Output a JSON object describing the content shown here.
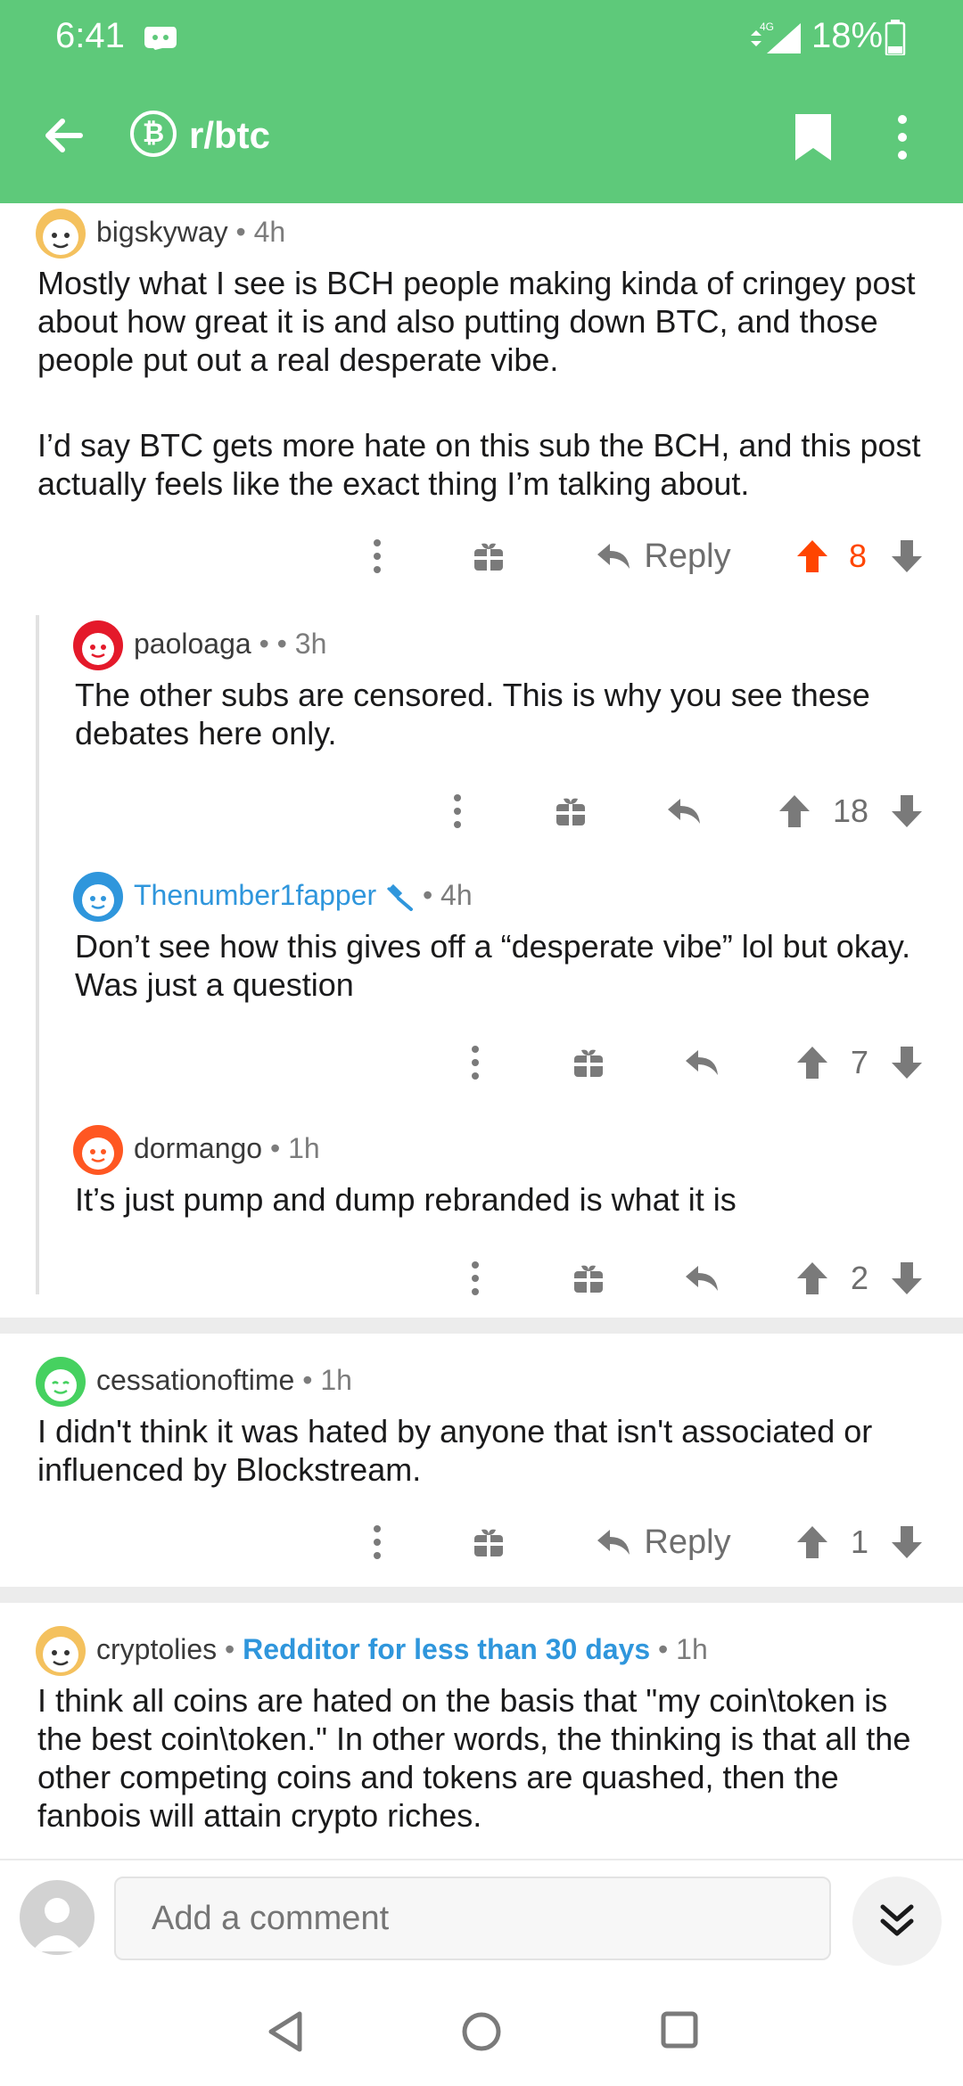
{
  "status_bar": {
    "time": "6:41",
    "network": "4G",
    "battery": "18%"
  },
  "toolbar": {
    "subreddit": "r/btc",
    "subreddit_icon": "bitcoin-icon"
  },
  "colors": {
    "header": "#5ec97a",
    "upvote_active": "#ff4500",
    "link_blue": "#2f96dc"
  },
  "comments": [
    {
      "author": "bigskyway",
      "sep": "•",
      "age": "4h",
      "text_p1": "Mostly what I see is BCH people making kinda of cringey post about how great it is and also putting down BTC, and those people put out a real desperate vibe.",
      "text_p2": "I’d say BTC gets more hate on this sub the BCH, and this post actually feels like the exact thing I’m talking about.",
      "reply_label": "Reply",
      "score": "8",
      "upvoted": true
    },
    {
      "author": "paoloaga",
      "sep": "• •",
      "age": "3h",
      "text": "The other subs are censored. This is why you see these debates here only.",
      "score": "18"
    },
    {
      "author": "Thenumber1fapper",
      "sep": "•",
      "age": "4h",
      "text": "Don’t see how this gives off a “desperate vibe” lol but okay. Was just a question",
      "score": "7"
    },
    {
      "author": "dormango",
      "sep": "•",
      "age": "1h",
      "text": "It’s just pump and dump rebranded is what it is",
      "score": "2"
    },
    {
      "author": "cessationoftime",
      "sep": "•",
      "age": "1h",
      "text": "I didn't think it was hated by anyone that isn't associated or influenced by Blockstream.",
      "reply_label": "Reply",
      "score": "1"
    },
    {
      "author": "cryptolies",
      "sep": "•",
      "flair": "Redditor for less than 30 days",
      "sep2": "•",
      "age": "1h",
      "text": "I think all coins are hated on the basis that \"my coin\\token is the best coin\\token.\" In other words, the thinking is that all the other competing coins and tokens are quashed, then the fanbois will attain crypto riches."
    }
  ],
  "compose": {
    "placeholder": "Add a comment"
  }
}
